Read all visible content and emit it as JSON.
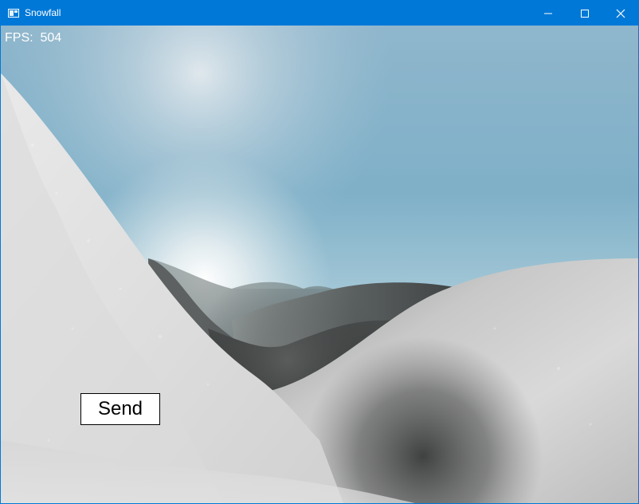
{
  "window": {
    "title": "Snowfall",
    "accent_color": "#0078d7",
    "controls": [
      "minimize-icon",
      "maximize-icon",
      "close-icon"
    ]
  },
  "hud": {
    "fps_label": "FPS:",
    "fps_value": "504"
  },
  "scene": {
    "description_icons": [
      "sun-glow",
      "snow-hills",
      "sky"
    ],
    "sky_top_color": "#6fa3c0",
    "sky_horizon_color": "#d9e8ee",
    "snow_light_color": "#e6e6e6",
    "snow_shadow_color": "#3a3a3a"
  },
  "send_button": {
    "label": "Send"
  }
}
